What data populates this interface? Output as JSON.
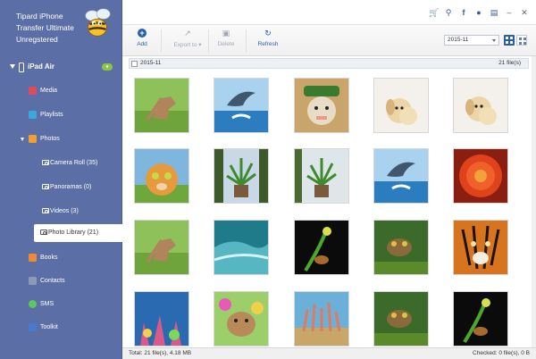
{
  "app": {
    "name_line1": "Tipard iPhone",
    "name_line2": "Transfer Ultimate",
    "reg_status": "Unregstered"
  },
  "device": {
    "name": "iPad Air"
  },
  "sidebar": {
    "items": [
      {
        "label": "Media",
        "color": "#e04a5a"
      },
      {
        "label": "Playlists",
        "color": "#3aa8d8"
      },
      {
        "label": "Photos",
        "color": "#f0a030"
      },
      {
        "label": "Camera Roll (35)"
      },
      {
        "label": "Panoramas (0)"
      },
      {
        "label": "Videos (3)"
      },
      {
        "label": "Photo Library (21)"
      },
      {
        "label": "Books",
        "color": "#f08a30"
      },
      {
        "label": "Contacts",
        "color": "#8a9ab8"
      },
      {
        "label": "SMS",
        "color": "#5bc85b"
      },
      {
        "label": "Toolkit",
        "color": "#4a7ad0"
      }
    ]
  },
  "toolbar": {
    "add": "Add",
    "export": "Export to",
    "delete": "Delete",
    "refresh": "Refresh",
    "date_selected": "2015-11"
  },
  "group": {
    "label": "2015-11",
    "count": "21 file(s)"
  },
  "status": {
    "total": "Total: 21 file(s), 4.18 MB",
    "checked": "Checked: 0 file(s), 0 B"
  },
  "colors": {
    "sidebar_bg": "#5b6fa6",
    "accent": "#2a5fa8",
    "badge": "#8cc63f"
  }
}
